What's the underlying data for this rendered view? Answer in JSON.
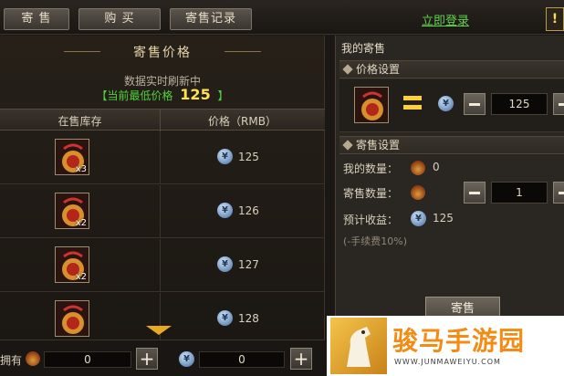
{
  "topbar": {
    "tabs": [
      "寄 售",
      "购 买",
      "寄售记录"
    ],
    "login": "立即登录",
    "alert": "!"
  },
  "left": {
    "title": "寄售价格",
    "refresh_note": "数据实时刷新中",
    "lowest_prefix": "【当前最低价格",
    "lowest_value": "125",
    "lowest_suffix": "】",
    "columns": [
      "在售库存",
      "价格（RMB）"
    ],
    "rows": [
      {
        "qty": "x3",
        "price": "125"
      },
      {
        "qty": "x2",
        "price": "126"
      },
      {
        "qty": "x2",
        "price": "127"
      },
      {
        "qty": "",
        "price": "128"
      }
    ]
  },
  "bottom": {
    "own_label": "拥有",
    "item_amount": "0",
    "coin_amount": "0"
  },
  "right": {
    "title": "我的寄售",
    "price_section": "价格设置",
    "price_value": "125",
    "sell_section": "寄售设置",
    "my_qty_label": "我的数量：",
    "my_qty": "0",
    "sell_qty_label": "寄售数量：",
    "sell_qty": "1",
    "income_label": "预计收益：",
    "income": "125",
    "fee_note": "(-手续费10%)",
    "sell_button": "寄售"
  },
  "watermark": {
    "text": "骏马手游园",
    "url": "WWW.JUNMAWEIYU.COM"
  },
  "colors": {
    "lowest_label": "#4fd23a",
    "lowest_value": "#ffe24d",
    "login": "#5fd34a",
    "accent": "#e8a826"
  }
}
